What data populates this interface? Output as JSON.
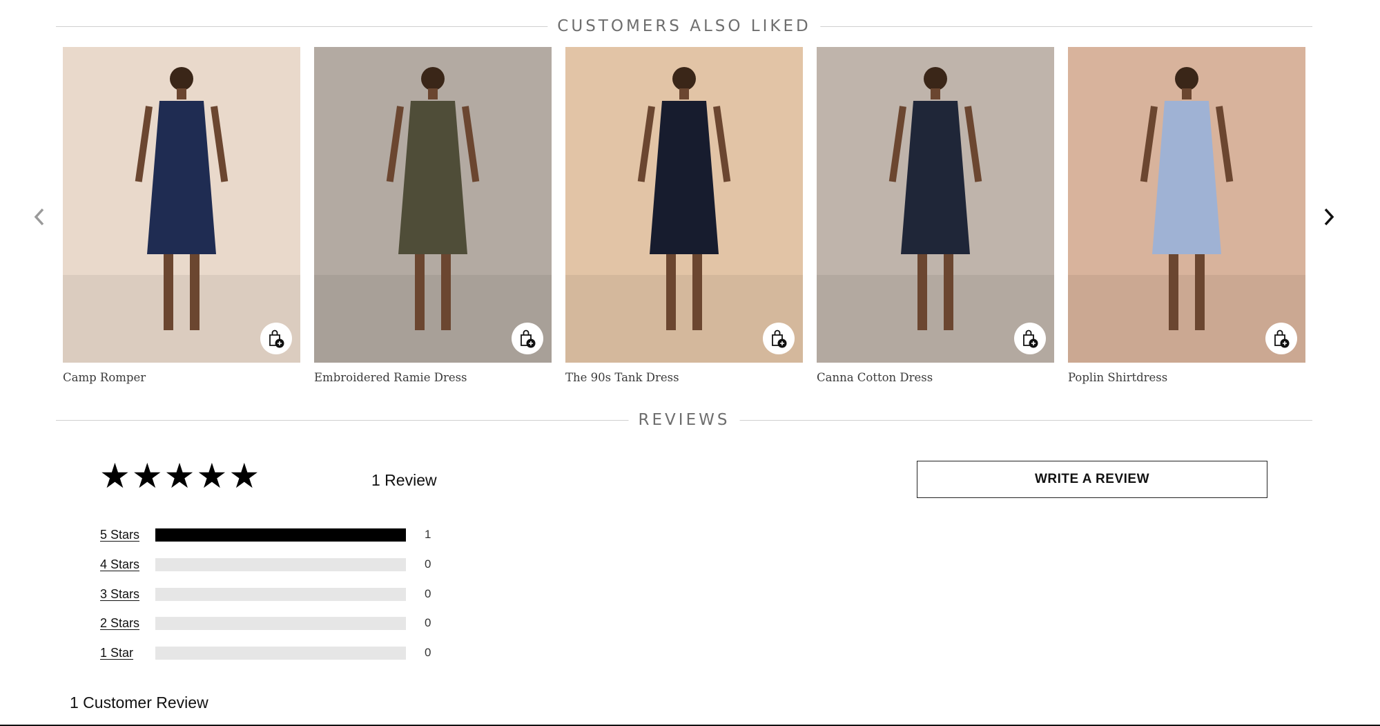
{
  "recommendations": {
    "heading": "CUSTOMERS ALSO LIKED",
    "prev_icon": "chevron-left-icon",
    "next_icon": "chevron-right-icon",
    "products": [
      {
        "name": "Camp Romper",
        "bg": "#e9d9cb",
        "outfit": "#1f2c52",
        "icon": "shopping-bag-add-icon"
      },
      {
        "name": "Embroidered Ramie Dress",
        "bg": "#b3aaa2",
        "outfit": "#4f4d38",
        "icon": "shopping-bag-add-icon"
      },
      {
        "name": "The 90s Tank Dress",
        "bg": "#e2c4a6",
        "outfit": "#171c2e",
        "icon": "shopping-bag-add-icon"
      },
      {
        "name": "Canna Cotton Dress",
        "bg": "#bfb4ab",
        "outfit": "#1f2638",
        "icon": "shopping-bag-add-icon"
      },
      {
        "name": "Poplin Shirtdress",
        "bg": "#d8b39c",
        "outfit": "#9fb2d4",
        "icon": "shopping-bag-add-icon"
      }
    ]
  },
  "reviews": {
    "heading": "REVIEWS",
    "average_stars": 5,
    "review_count_label": "1 Review",
    "write_review_label": "WRITE A REVIEW",
    "histogram": [
      {
        "label": "5 Stars",
        "count": "1",
        "fraction": 1.0
      },
      {
        "label": "4 Stars",
        "count": "0",
        "fraction": 0
      },
      {
        "label": "3 Stars",
        "count": "0",
        "fraction": 0
      },
      {
        "label": "2 Stars",
        "count": "0",
        "fraction": 0
      },
      {
        "label": "1 Star",
        "count": "0",
        "fraction": 0
      }
    ],
    "customer_review_heading": "1 Customer Review"
  }
}
